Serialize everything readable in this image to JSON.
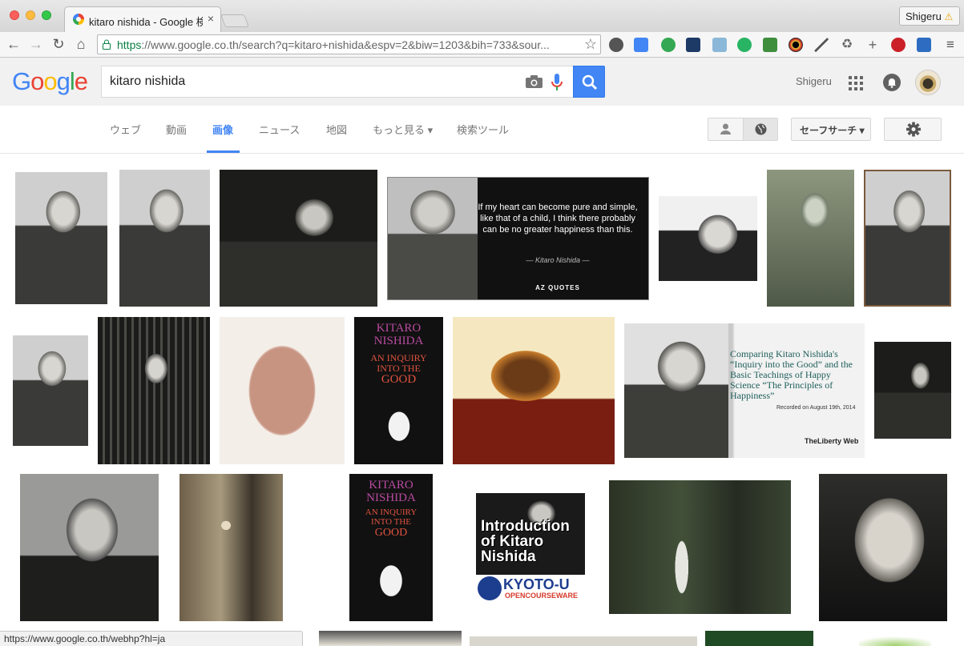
{
  "browser": {
    "tab_title": "kitaro nishida - Google 検索",
    "profile_name": "Shigeru",
    "url_scheme": "https",
    "url_rest": "://www.google.co.th/search?q=kitaro+nishida&espv=2&biw=1203&bih=733&sour...",
    "status_url": "https://www.google.co.th/webhp?hl=ja"
  },
  "google": {
    "logo": [
      "G",
      "o",
      "o",
      "g",
      "l",
      "e"
    ],
    "logo_colors": [
      "#4285f4",
      "#ea4335",
      "#fbbc05",
      "#4285f4",
      "#34a853",
      "#ea4335"
    ],
    "query": "kitaro nishida",
    "user_name": "Shigeru",
    "tabs": [
      "ウェブ",
      "動画",
      "画像",
      "ニュース",
      "地図",
      "もっと見る ▾",
      "検索ツール"
    ],
    "active_tab": "画像",
    "safe_search": "セーフサーチ ▾"
  },
  "thumbs": {
    "quote_text": "If my heart can become pure and simple, like that of a child, I think there probably can be no greater happiness than this.",
    "quote_author": "— Kitaro Nishida —",
    "quote_brand": "AZ QUOTES",
    "book_line1": "KITARO",
    "book_line2": "NISHIDA",
    "book_line3": "AN INQUIRY",
    "book_line4": "INTO THE",
    "book_line5": "GOOD",
    "liberty_title": "Comparing Kitaro Nishida's “Inquiry into the Good” and the Basic Teachings of Happy Science “The Principles of Happiness”",
    "liberty_date": "Recorded on August 19th, 2014",
    "liberty_brand": "TheLiberty Web",
    "kyoto_title": "Introduction of Kitaro Nishida",
    "kyoto_brand": "KYOTO-U",
    "kyoto_sub": "OPENCOURSEWARE"
  },
  "colors": {
    "accent": "#4285f4",
    "header_bg": "#f1f1f1"
  }
}
